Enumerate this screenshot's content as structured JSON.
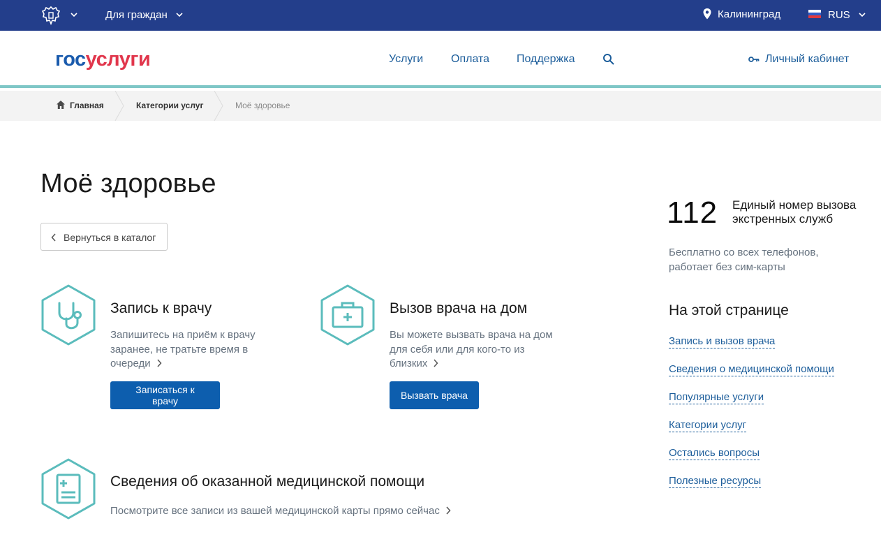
{
  "topbar": {
    "audience_label": "Для граждан",
    "city": "Калининград",
    "language": "RUS"
  },
  "header": {
    "logo_part1": "гос",
    "logo_part2": "услуги",
    "nav": [
      "Услуги",
      "Оплата",
      "Поддержка"
    ],
    "cabinet_label": "Личный кабинет"
  },
  "breadcrumbs": {
    "home": "Главная",
    "categories": "Категории услуг",
    "current": "Моё здоровье"
  },
  "main": {
    "title": "Моё здоровье",
    "back_label": "Вернуться в каталог",
    "cards": [
      {
        "title": "Запись к врачу",
        "desc_lines": [
          "Запишитесь на приём к врачу",
          "заранее, не тратьте время в",
          "очереди"
        ],
        "button": "Записаться к врачу",
        "icon": "stethoscope-icon"
      },
      {
        "title": "Вызов врача на дом",
        "desc_lines": [
          "Вы можете вызвать врача на дом",
          "для себя или для кого-то из",
          "близких"
        ],
        "button": "Вызвать врача",
        "icon": "medical-case-icon"
      },
      {
        "title": "Сведения об оказанной медицинской помощи",
        "desc_lines": [
          "Посмотрите все записи из вашей медицинской карты прямо сейчас"
        ],
        "icon": "medical-record-icon"
      }
    ]
  },
  "sidebar": {
    "emergency_number": "112",
    "emergency_desc": "Единый номер вызова экстренных служб",
    "free_text": "Бесплатно со всех телефонов, работает без сим-карты",
    "on_page_title": "На этой странице",
    "links": [
      "Запись и вызов врача",
      "Сведения о медицинской помощи",
      "Популярные услуги",
      "Категории услуг",
      "Остались вопросы",
      "Полезные ресурсы"
    ]
  },
  "colors": {
    "topbar": "#233e8b",
    "accent_teal": "#5bbcbc",
    "button_blue": "#0d5eae",
    "link_blue": "#1d5e9b",
    "logo_blue": "#1a5bad",
    "logo_red": "#e1364c"
  }
}
